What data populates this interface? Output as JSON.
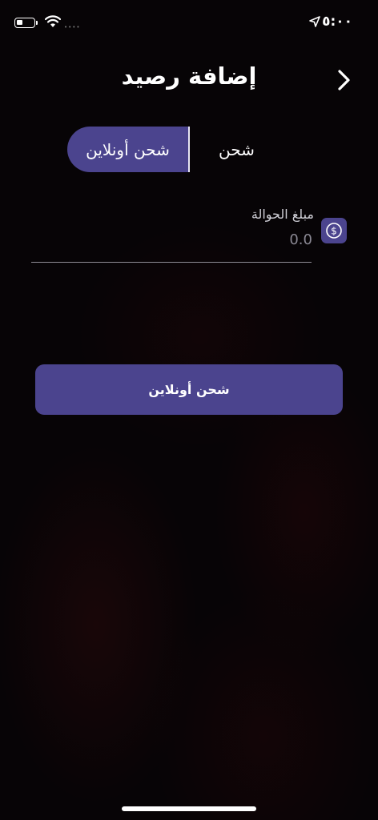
{
  "status_bar": {
    "time": "٥:٠٠",
    "signal": "••••"
  },
  "header": {
    "title": "إضافة رصيد",
    "back_icon": "chevron-right-icon"
  },
  "tabs": {
    "active": "شحن أونلاين",
    "inactive": "شحن"
  },
  "amount_field": {
    "label": "مبلغ الحوالة",
    "placeholder": "0.0",
    "icon": "dollar-circle-icon"
  },
  "primary_button": {
    "label": "شحن أونلاين"
  },
  "colors": {
    "accent": "#4b448e",
    "background": "#070406"
  }
}
